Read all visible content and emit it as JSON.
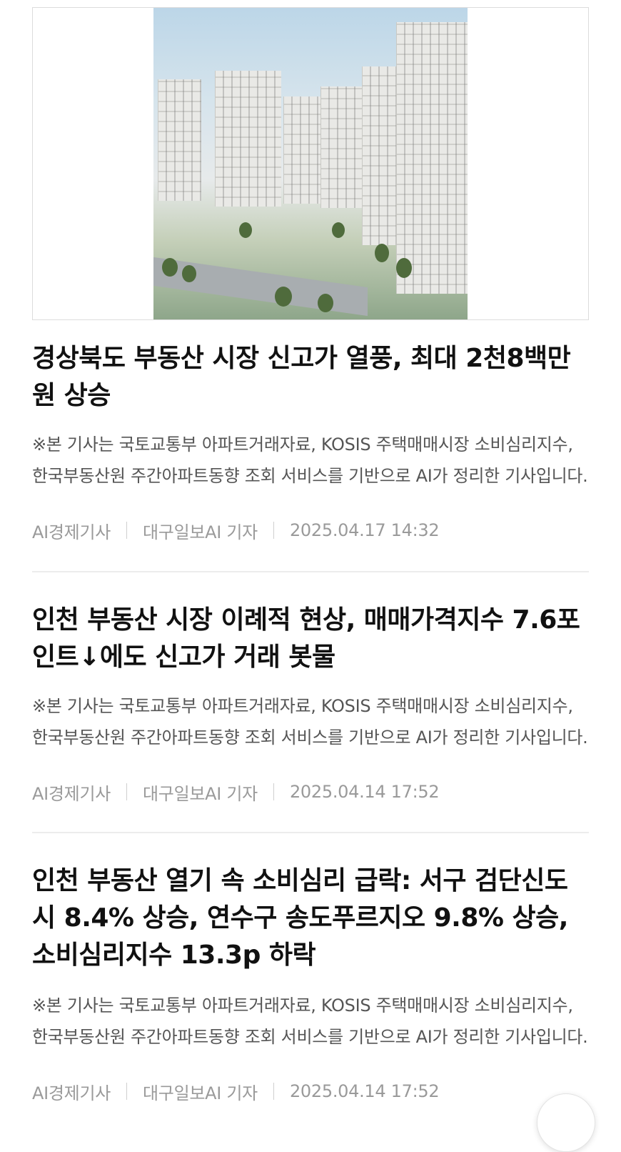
{
  "articles": [
    {
      "has_thumbnail": true,
      "title": "경상북도 부동산 시장 신고가 열풍, 최대 2천8백만원 상승",
      "summary": "※본 기사는 국토교통부 아파트거래자료, KOSIS 주택매매시장 소비심리지수, 한국부동산원 주간아파트동향 조회 서비스를 기반으로 AI가 정리한 기사입니다.",
      "category": "AI경제기사",
      "author": "대구일보AI 기자",
      "datetime": "2025.04.17 14:32"
    },
    {
      "has_thumbnail": false,
      "title": "인천 부동산 시장 이례적 현상, 매매가격지수 7.6포인트↓에도 신고가 거래 봇물",
      "summary": "※본 기사는 국토교통부 아파트거래자료, KOSIS 주택매매시장 소비심리지수, 한국부동산원 주간아파트동향 조회 서비스를 기반으로 AI가 정리한 기사입니다.",
      "category": "AI경제기사",
      "author": "대구일보AI 기자",
      "datetime": "2025.04.14 17:52"
    },
    {
      "has_thumbnail": false,
      "title": "인천 부동산 열기 속 소비심리 급락: 서구 검단신도시 8.4% 상승, 연수구 송도푸르지오 9.8% 상승, 소비심리지수 13.3p 하락",
      "summary": "※본 기사는 국토교통부 아파트거래자료, KOSIS 주택매매시장 소비심리지수, 한국부동산원 주간아파트동향 조회 서비스를 기반으로 AI가 정리한 기사입니다.",
      "category": "AI경제기사",
      "author": "대구일보AI 기자",
      "datetime": "2025.04.14 17:52"
    }
  ],
  "fab_icon": "scroll-top-icon"
}
